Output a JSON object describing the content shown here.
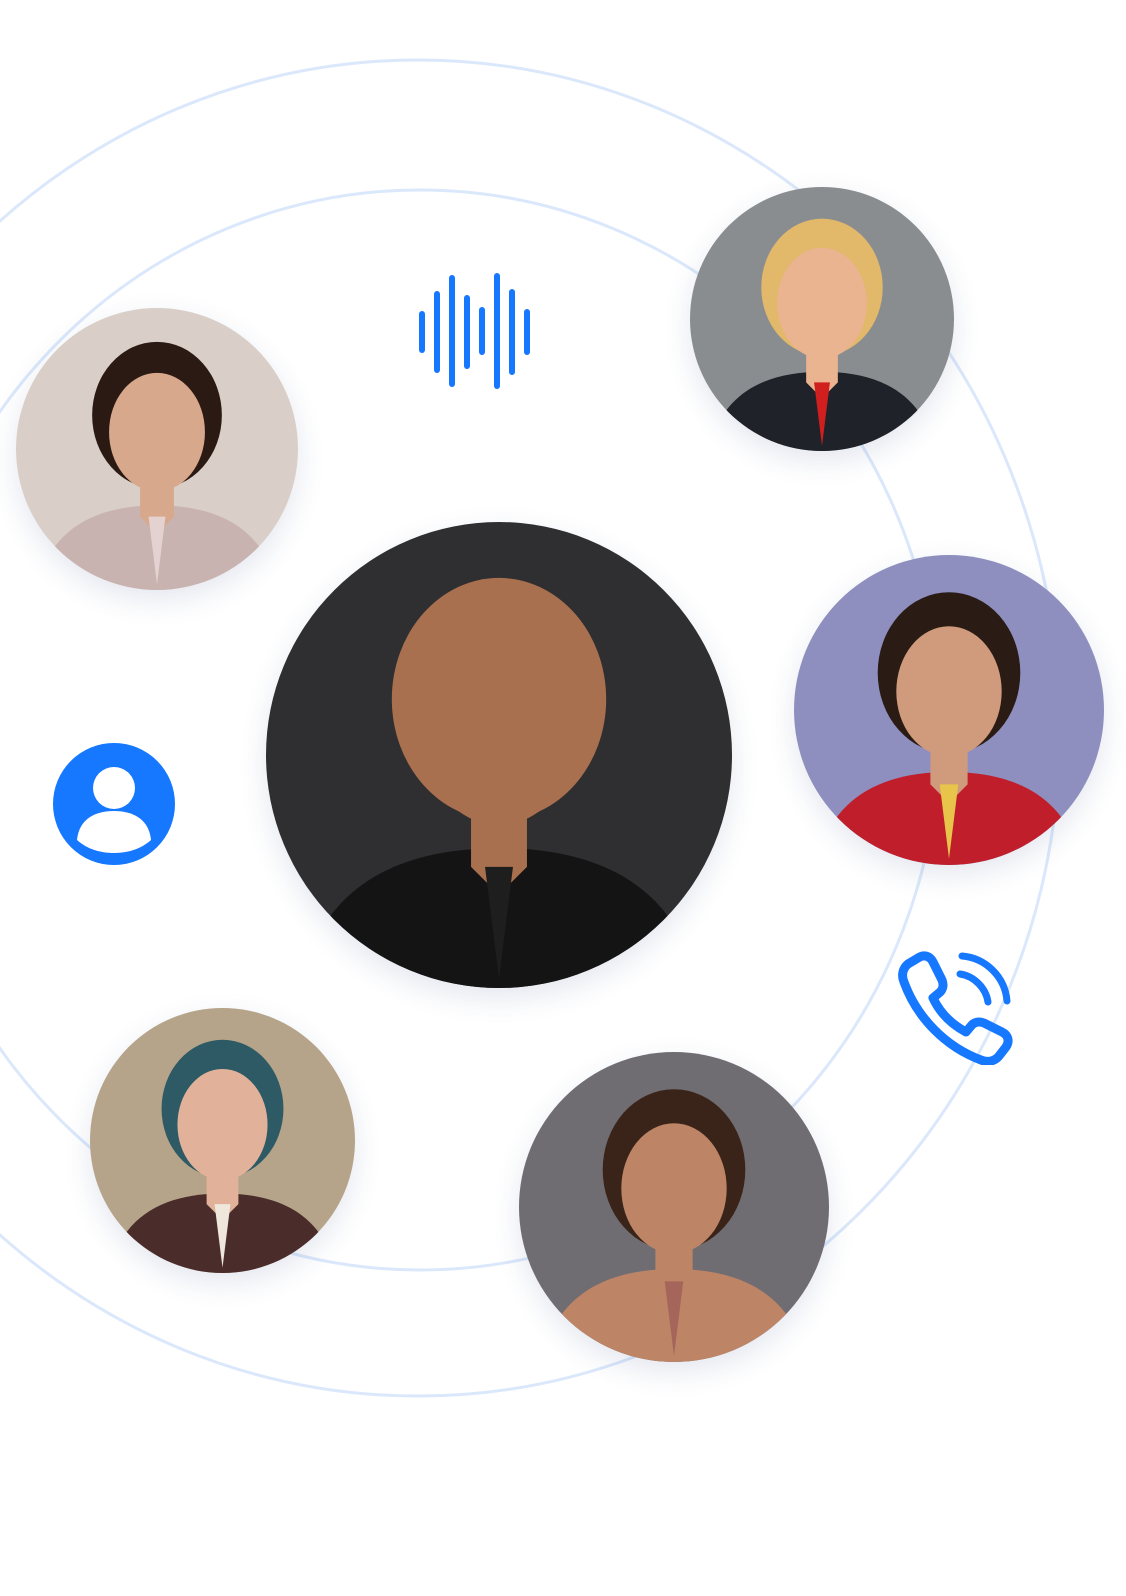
{
  "theme": {
    "accent": "#1677ff",
    "orbit_line": "#dbe8fb",
    "background": "#ffffff"
  },
  "avatars": [
    {
      "id": "top-right",
      "palette": {
        "bg": "#8a8d90",
        "skin": "#e9b48f",
        "hair": "#e2b86a",
        "clothes": "#1f2329",
        "accent": "#d11f1f"
      }
    },
    {
      "id": "upper-left",
      "palette": {
        "bg": "#d9cfc8",
        "skin": "#d8a88c",
        "hair": "#2b1a14",
        "clothes": "#c9b3b1",
        "accent": "#e3d2cf"
      }
    },
    {
      "id": "center",
      "palette": {
        "bg": "#2f2f31",
        "skin": "#a9704f",
        "hair": "#a9704f",
        "clothes": "#141414",
        "accent": "#1e1e1e"
      }
    },
    {
      "id": "right",
      "palette": {
        "bg": "#8e8fbf",
        "skin": "#d09a7c",
        "hair": "#2a1c14",
        "clothes": "#bf1e2a",
        "accent": "#e8c44a"
      }
    },
    {
      "id": "lower-left",
      "palette": {
        "bg": "#b6a48a",
        "skin": "#e1b199",
        "hair": "#2d5a64",
        "clothes": "#4a2d2a",
        "accent": "#efe6dc"
      }
    },
    {
      "id": "lower-center",
      "palette": {
        "bg": "#6f6c72",
        "skin": "#bd8466",
        "hair": "#3a2419",
        "clothes": "#bd8466",
        "accent": "#a6655a"
      }
    }
  ],
  "icons": {
    "waveform": "waveform-icon",
    "user": "user-icon",
    "phone": "phone-ringing-icon"
  }
}
